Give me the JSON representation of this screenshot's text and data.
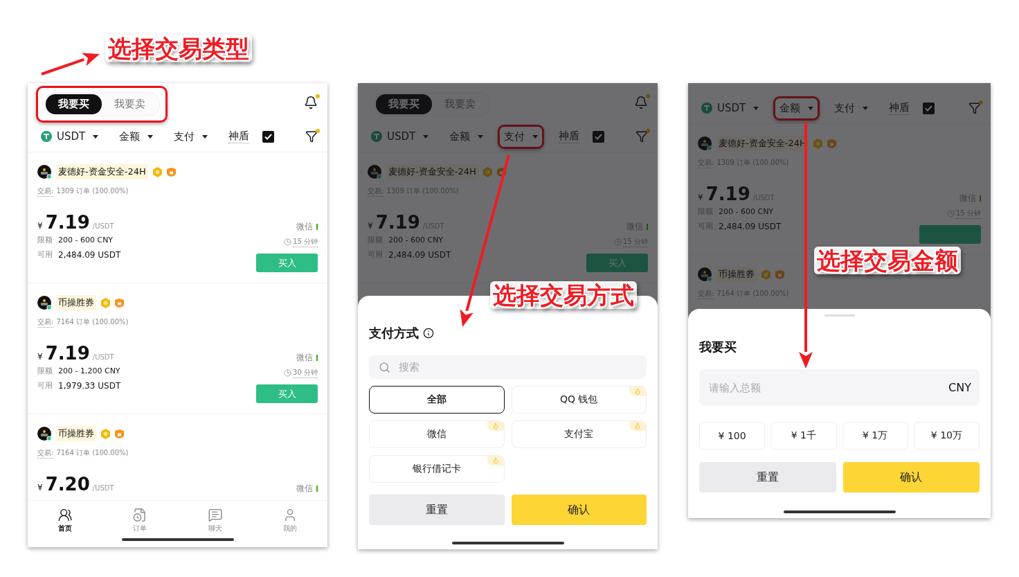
{
  "panels": [
    {
      "dimmed": false,
      "callout": "选择交易类型",
      "tabs_highlighted": true,
      "tabs": [
        {
          "label": "我要买",
          "selected": true
        },
        {
          "label": "我要卖",
          "selected": false
        }
      ],
      "filters": [
        {
          "kind": "coin",
          "label": "USDT",
          "highlighted": false
        },
        {
          "kind": "dropdown",
          "label": "金额",
          "highlighted": false
        },
        {
          "kind": "dropdown",
          "label": "支付",
          "highlighted": false
        },
        {
          "kind": "checkbox",
          "label": "神盾",
          "checked": true,
          "highlighted": false
        }
      ],
      "listings": [
        {
          "name": "麦德好-资金安全-24H",
          "online": true,
          "trades_label": "交易:",
          "trades": "1309 订单 (100.00%)",
          "currency": "¥",
          "price": "7.19",
          "unit": "/USDT",
          "limit_label": "限额",
          "limit": "200 - 600 CNY",
          "available_label": "可用",
          "available": "2,484.09 USDT",
          "method": "微信",
          "time": "15 分钟",
          "buy": "买入"
        },
        {
          "name": "币操胜券",
          "online": true,
          "trades_label": "交易:",
          "trades": "7164 订单 (100.00%)",
          "currency": "¥",
          "price": "7.19",
          "unit": "/USDT",
          "limit_label": "限额",
          "limit": "200 - 1,200 CNY",
          "available_label": "可用",
          "available": "1,979.33 USDT",
          "method": "微信",
          "time": "30 分钟",
          "buy": "买入"
        },
        {
          "name": "币操胜券",
          "online": true,
          "trades_label": "交易:",
          "trades": "7164 订单 (100.00%)",
          "currency": "¥",
          "price": "7.20",
          "unit": "/USDT",
          "method": "微信"
        }
      ],
      "nav": [
        {
          "kind": "home",
          "label": "首页",
          "selected": true
        },
        {
          "kind": "orders",
          "label": "订单",
          "selected": false
        },
        {
          "kind": "chat",
          "label": "聊天",
          "selected": false
        },
        {
          "kind": "profile",
          "label": "我的",
          "selected": false
        }
      ]
    },
    {
      "dimmed": true,
      "callout": "选择交易方式",
      "tabs": [
        {
          "label": "我要买",
          "selected": true
        },
        {
          "label": "我要卖",
          "selected": false
        }
      ],
      "filters": [
        {
          "kind": "coin",
          "label": "USDT",
          "highlighted": false
        },
        {
          "kind": "dropdown",
          "label": "金额",
          "highlighted": false
        },
        {
          "kind": "dropdown",
          "label": "支付",
          "highlighted": true
        },
        {
          "kind": "checkbox",
          "label": "神盾",
          "checked": true,
          "highlighted": false
        }
      ],
      "listings": [
        {
          "name": "麦德好-资金安全-24H",
          "online": true,
          "trades_label": "交易:",
          "trades": "1309 订单 (100.00%)",
          "currency": "¥",
          "price": "7.19",
          "unit": "/USDT",
          "limit_label": "限额",
          "limit": "200 - 600 CNY",
          "available_label": "可用",
          "available": "2,484.09 USDT",
          "method": "微信",
          "time": "15 分钟",
          "buy": "买入"
        }
      ],
      "sheet": {
        "kind": "payment",
        "title": "支付方式",
        "search_placeholder": "搜索",
        "options": [
          {
            "label": "全部",
            "selected": true,
            "hot": false
          },
          {
            "label": "QQ 钱包",
            "selected": false,
            "hot": true
          },
          {
            "label": "微信",
            "selected": false,
            "hot": true
          },
          {
            "label": "支付宝",
            "selected": false,
            "hot": true
          },
          {
            "label": "银行借记卡",
            "selected": false,
            "hot": true
          }
        ],
        "reset": "重置",
        "confirm": "确认"
      }
    },
    {
      "dimmed": true,
      "callout": "选择交易金额",
      "filters": [
        {
          "kind": "coin",
          "label": "USDT",
          "highlighted": false
        },
        {
          "kind": "dropdown",
          "label": "金额",
          "highlighted": true
        },
        {
          "kind": "dropdown",
          "label": "支付",
          "highlighted": false
        },
        {
          "kind": "checkbox",
          "label": "神盾",
          "checked": true,
          "highlighted": false
        }
      ],
      "listings": [
        {
          "name": "麦德好-资金安全-24H",
          "online": true,
          "trades_label": "交易:",
          "trades": "1309 订单 (100.00%)",
          "currency": "¥",
          "price": "7.19",
          "unit": "/USDT",
          "limit_label": "限额",
          "limit": "200 - 600 CNY",
          "available_label": "可用",
          "available": "2,484.09 USDT",
          "method": "微信",
          "time": "15 分钟",
          "buy_button": true
        },
        {
          "name": "币操胜券",
          "online": true,
          "trades_label": "交易:",
          "trades": "7164 订单 (100.00%)"
        }
      ],
      "sheet": {
        "kind": "amount",
        "title": "我要买",
        "placeholder": "请输入总额",
        "currency": "CNY",
        "presets": [
          "¥ 100",
          "¥ 1千",
          "¥ 1万",
          "¥ 10万"
        ],
        "reset": "重置",
        "confirm": "确认"
      }
    }
  ]
}
